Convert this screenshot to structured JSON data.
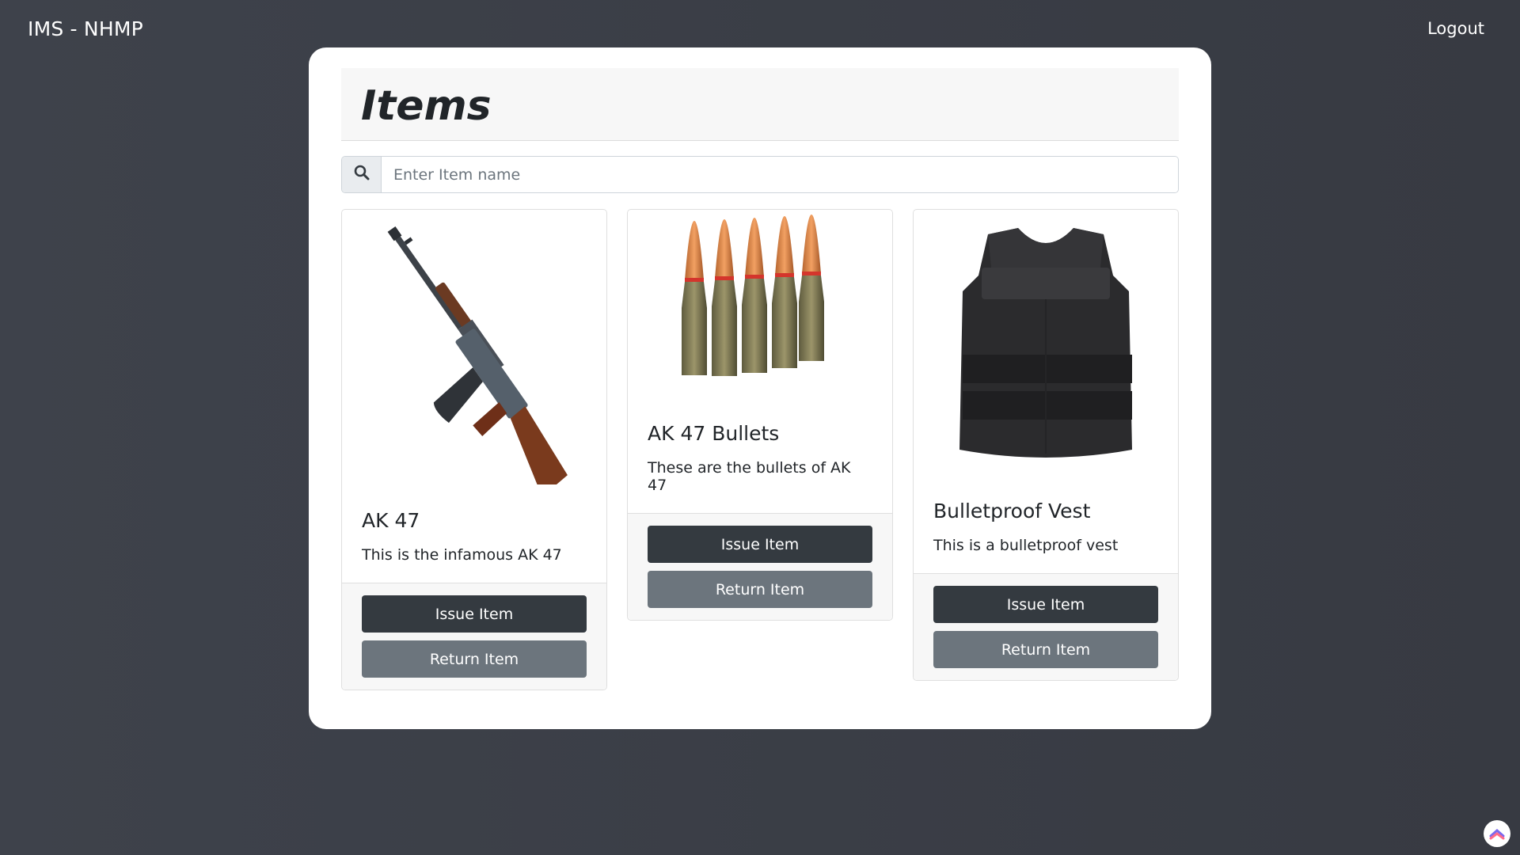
{
  "navbar": {
    "brand": "IMS - NHMP",
    "logout": "Logout"
  },
  "page": {
    "title": "Items"
  },
  "search": {
    "placeholder": "Enter Item name",
    "value": "",
    "icon": "search-icon"
  },
  "items": [
    {
      "title": "AK 47",
      "description": "This is the infamous AK 47",
      "image_icon": "rifle-image",
      "issue_label": "Issue Item",
      "return_label": "Return Item"
    },
    {
      "title": "AK 47 Bullets",
      "description": "These are the bullets of AK 47",
      "image_icon": "bullets-image",
      "issue_label": "Issue Item",
      "return_label": "Return Item"
    },
    {
      "title": "Bulletproof Vest",
      "description": "This is a bulletproof vest",
      "image_icon": "vest-image",
      "issue_label": "Issue Item",
      "return_label": "Return Item"
    }
  ],
  "colors": {
    "background": "#3a3d45",
    "issue_button": "#343a40",
    "return_button": "#6c757d",
    "panel": "#ffffff"
  }
}
